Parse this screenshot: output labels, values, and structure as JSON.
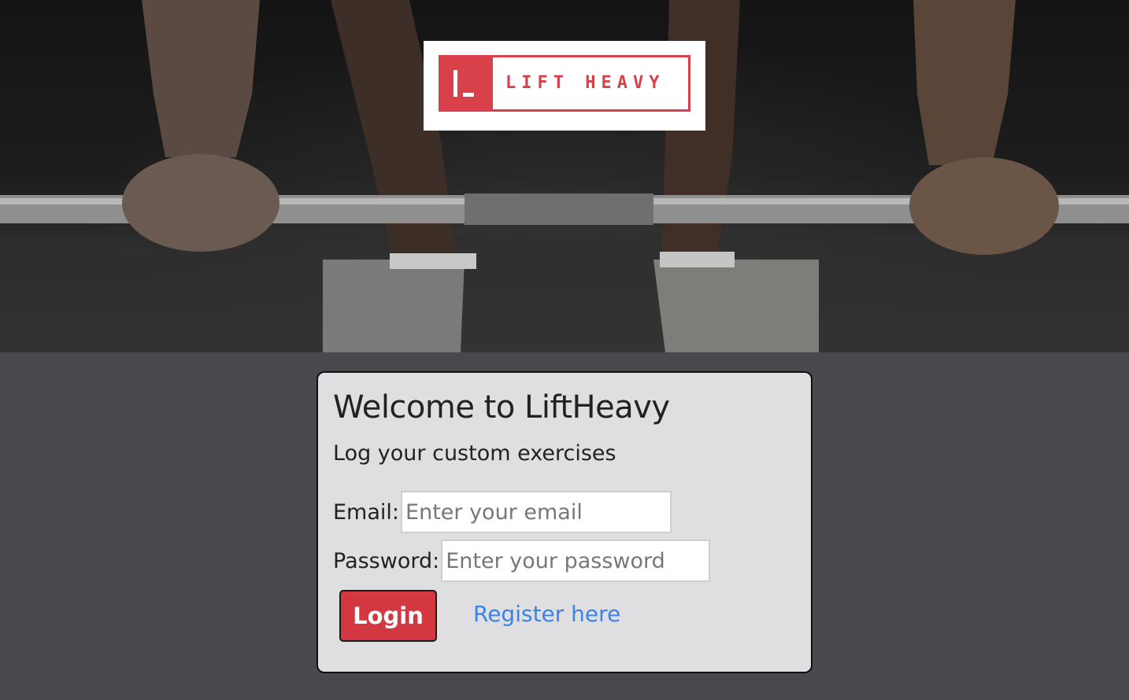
{
  "hero": {
    "logo_text": "LIFT HEAVY",
    "brand_color": "#d8404a"
  },
  "card": {
    "title": "Welcome to LiftHeavy",
    "subtitle": "Log your custom exercises",
    "email_label": "Email:",
    "email_placeholder": "Enter your email",
    "email_value": "",
    "password_label": "Password:",
    "password_placeholder": "Enter your password",
    "password_value": "",
    "login_label": "Login",
    "register_label": "Register here"
  },
  "colors": {
    "page_bg": "#48494c",
    "card_bg": "#dfdfe1",
    "login_button": "#d33841",
    "link": "#3b83e6"
  }
}
